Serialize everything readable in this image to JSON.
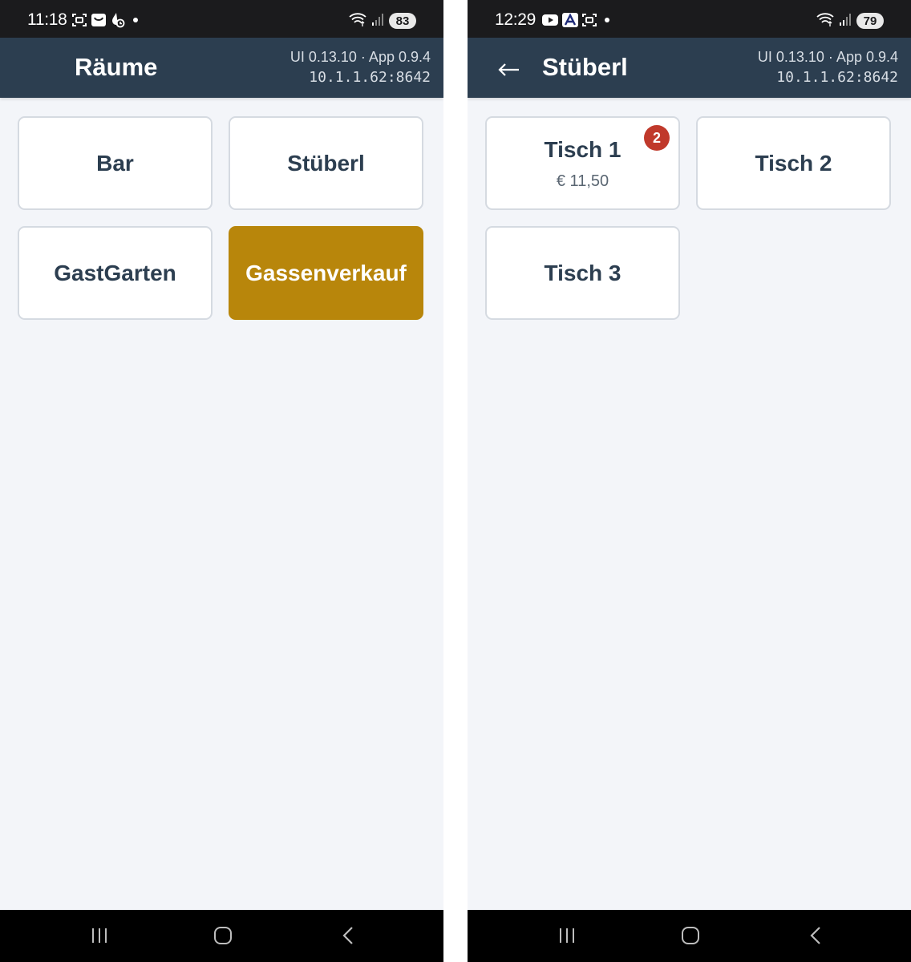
{
  "left": {
    "status": {
      "time": "11:18",
      "battery": "83",
      "left_icons": [
        "screenshot-icon",
        "shopping-bag-icon",
        "drop-timer-icon"
      ]
    },
    "header": {
      "title": "Räume",
      "version": "UI 0.13.10 · App 0.9.4",
      "server": "10.1.1.62:8642"
    },
    "rooms": [
      {
        "label": "Bar"
      },
      {
        "label": "Stüberl"
      },
      {
        "label": "GastGarten"
      },
      {
        "label": "Gassenverkauf",
        "highlighted": true
      }
    ]
  },
  "right": {
    "status": {
      "time": "12:29",
      "battery": "79",
      "left_icons": [
        "youtube-icon",
        "a-app-icon",
        "screenshot-icon"
      ]
    },
    "header": {
      "title": "Stüberl",
      "version": "UI 0.13.10 · App 0.9.4",
      "server": "10.1.1.62:8642"
    },
    "tables": [
      {
        "label": "Tisch 1",
        "amount": "€ 11,50",
        "badge": "2"
      },
      {
        "label": "Tisch 2"
      },
      {
        "label": "Tisch 3"
      }
    ]
  },
  "colors": {
    "header_bg": "#2c3e50",
    "highlight_tile": "#b8860b",
    "badge": "#c0392b",
    "page_bg": "#f3f5f9"
  }
}
